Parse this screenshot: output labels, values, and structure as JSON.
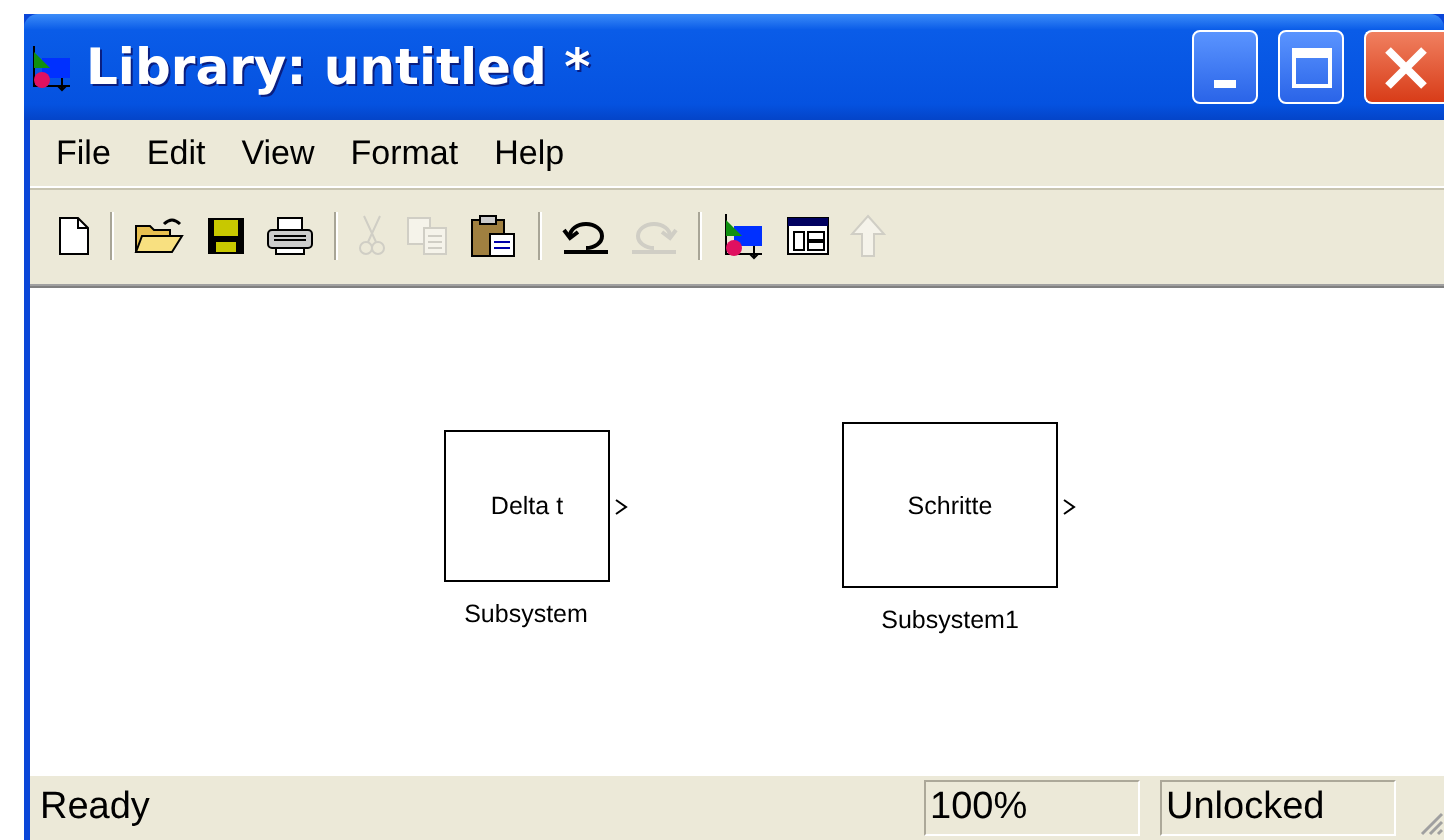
{
  "window": {
    "title": "Library: untitled *"
  },
  "menu": [
    {
      "label": "File"
    },
    {
      "label": "Edit"
    },
    {
      "label": "View"
    },
    {
      "label": "Format"
    },
    {
      "label": "Help"
    }
  ],
  "toolbar": [
    {
      "kind": "new",
      "disabled": false
    },
    {
      "kind": "separator"
    },
    {
      "kind": "open",
      "disabled": false
    },
    {
      "kind": "save",
      "disabled": false
    },
    {
      "kind": "print",
      "disabled": false
    },
    {
      "kind": "separator"
    },
    {
      "kind": "cut",
      "disabled": true
    },
    {
      "kind": "copy",
      "disabled": true
    },
    {
      "kind": "paste",
      "disabled": false
    },
    {
      "kind": "separator"
    },
    {
      "kind": "undo",
      "disabled": false
    },
    {
      "kind": "redo",
      "disabled": true
    },
    {
      "kind": "separator"
    },
    {
      "kind": "library",
      "disabled": false
    },
    {
      "kind": "explorer",
      "disabled": false
    },
    {
      "kind": "up",
      "disabled": true
    }
  ],
  "blocks": [
    {
      "text": "Delta t",
      "label": "Subsystem"
    },
    {
      "text": "Schritte",
      "label": "Subsystem1"
    }
  ],
  "status_bar": {
    "message": "Ready",
    "zoom": "100%",
    "lock": "Unlocked"
  }
}
